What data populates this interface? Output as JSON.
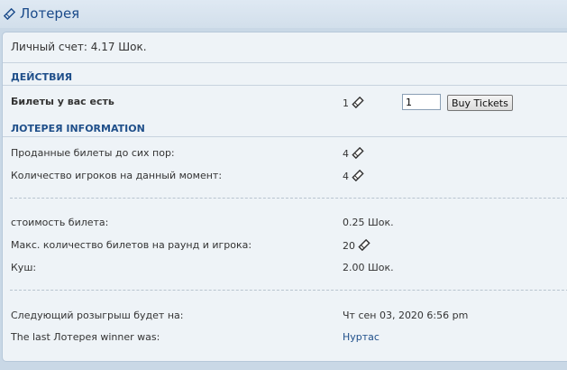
{
  "header": {
    "title": "Лотерея"
  },
  "balance": "Личный счет: 4.17 Шок.",
  "actions": {
    "heading": "ДЕЙСТВИЯ",
    "tickets_label": "Билеты у вас есть",
    "tickets_value": "1",
    "quantity_value": "1",
    "buy_label": "Buy Tickets"
  },
  "info": {
    "heading": "ЛОТЕРЕЯ INFORMATION",
    "rows": [
      {
        "label": "Проданные билеты до сих пор:",
        "value": "4"
      },
      {
        "label": "Количество игроков на данный момент:",
        "value": "4"
      },
      {
        "label": "стоимость билета:",
        "value": "0.25 Шок."
      },
      {
        "label": "Макс. количество билетов на раунд и игрока:",
        "value": "20"
      },
      {
        "label": "Куш:",
        "value": "2.00 Шок."
      },
      {
        "label": "Следующий розыгрыш будет на:",
        "value": "Чт сен 03, 2020 6:56 pm"
      },
      {
        "label": "The last Лотерея winner was:",
        "value": "Нуртас"
      }
    ]
  },
  "icons": {
    "ticket": "ticket-icon"
  },
  "colors": {
    "heading": "#1f4f8a",
    "title": "#1a4a8a",
    "panel_bg": "#eef3f7",
    "page_bg": "#c9d8e6"
  }
}
